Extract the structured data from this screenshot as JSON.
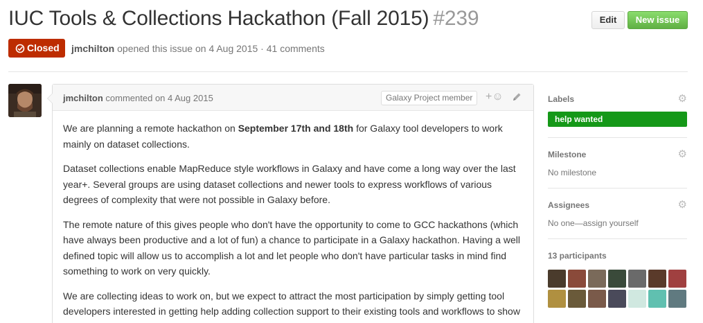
{
  "issue": {
    "title": "IUC Tools & Collections Hackathon (Fall 2015)",
    "number": "#239",
    "state": "Closed",
    "author": "jmchilton",
    "meta_text": "opened this issue on 4 Aug 2015 · 41 comments"
  },
  "toolbar": {
    "edit_label": "Edit",
    "new_issue_label": "New issue"
  },
  "comment": {
    "author": "jmchilton",
    "meta_text": "commented on 4 Aug 2015",
    "badge": "Galaxy Project member",
    "reaction_icon": "+☺",
    "p1_pre": "We are planning a remote hackathon on ",
    "p1_bold": "September 17th and 18th",
    "p1_post": " for Galaxy tool developers to work mainly on dataset collections.",
    "p2": "Dataset collections enable MapReduce style workflows in Galaxy and have come a long way over the last year+. Several groups are using dataset collections and newer tools to express workflows of various degrees of complexity that were not possible in Galaxy before.",
    "p3": "The remote nature of this gives people who don't have the opportunity to come to GCC hackathons (which have always been productive and a lot of fun) a chance to participate in a Galaxy hackathon. Having a well defined topic will allow us to accomplish a lot and let people who don't have particular tasks in mind find something to work on very quickly.",
    "p4": "We are collecting ideas to work on, but we expect to attract the most participation by simply getting tool developers interested in getting help adding collection support to their existing tools and workflows to show"
  },
  "sidebar": {
    "labels_title": "Labels",
    "label": "help wanted",
    "label_color": "#159818",
    "milestone_title": "Milestone",
    "milestone_value": "No milestone",
    "assignees_title": "Assignees",
    "assignees_value": "No one—assign yourself",
    "participants_title": "13 participants",
    "participant_colors": [
      "#4a3b2c",
      "#8a4a3a",
      "#7a6a5a",
      "#3a4a3a",
      "#6a6a6a",
      "#5a3a2a",
      "#a04040",
      "#b09040",
      "#6a5a3a",
      "#7a5a4a",
      "#4a4a5a",
      "#d0e8e0",
      "#60c0b0",
      "#607a80"
    ]
  },
  "colors": {
    "closed": "#bd2c00",
    "new_issue": "#60b044"
  }
}
